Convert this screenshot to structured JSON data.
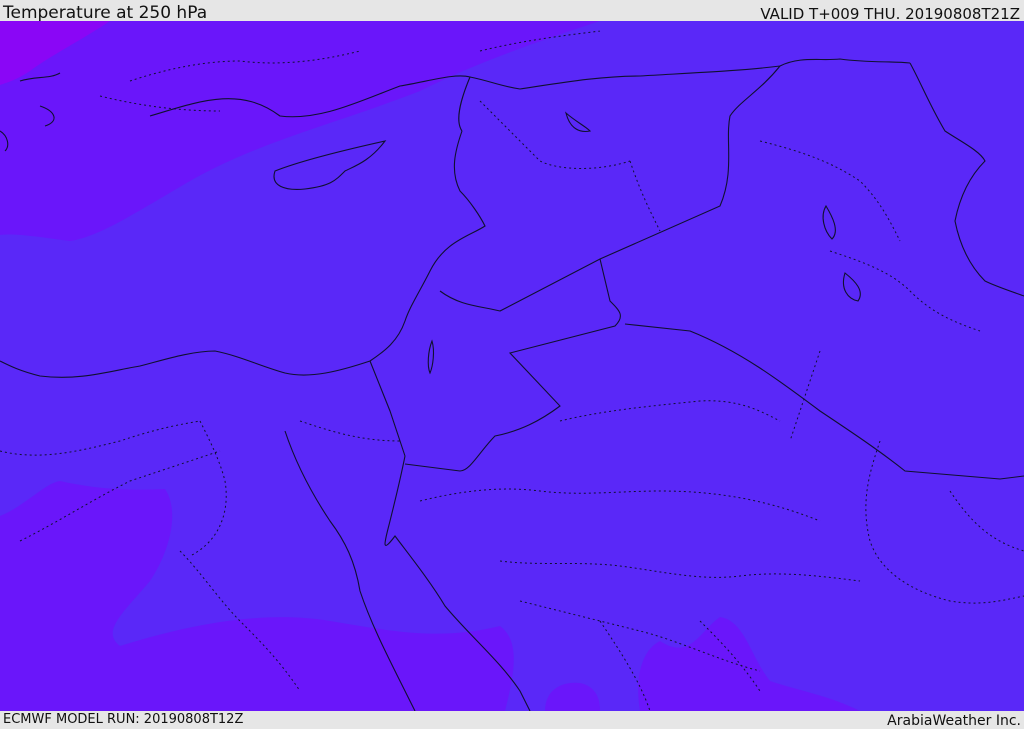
{
  "header": {
    "title": "Temperature at 250 hPa",
    "valid": "VALID T+009 THU. 20190808T21Z"
  },
  "footer": {
    "model_run": "ECMWF MODEL RUN: 20190808T12Z",
    "credit": "ArabiaWeather Inc."
  },
  "colors": {
    "field_main": "#5a28f8",
    "field_cold": "#6a16fa",
    "field_coldest": "#8a06f6",
    "boundary": "#101030"
  }
}
